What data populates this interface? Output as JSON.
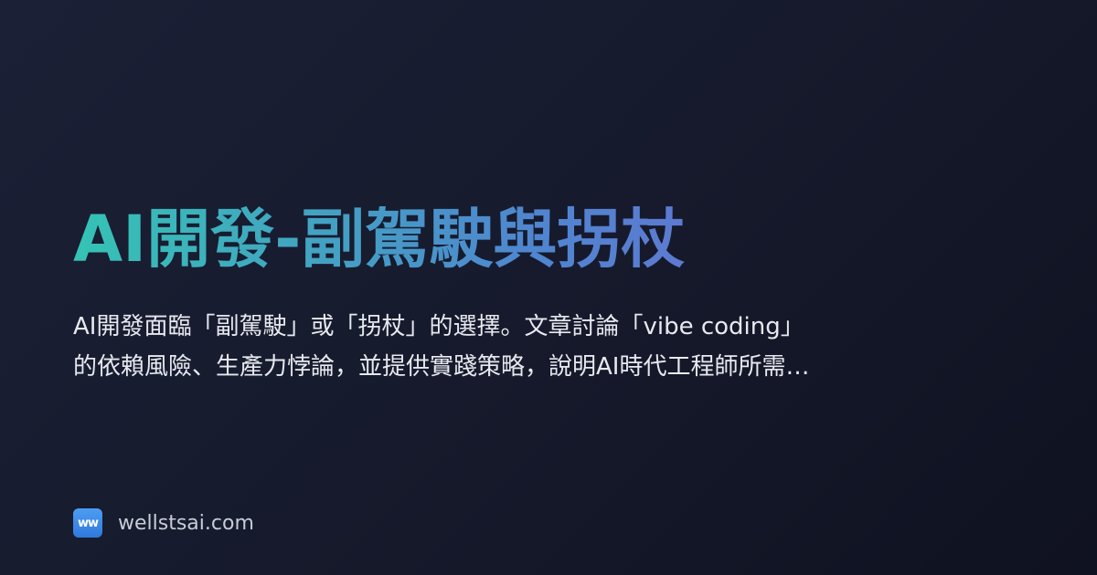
{
  "card": {
    "title": "AI開發-副駕駛與拐杖",
    "description_line1": "AI開發面臨「副駕駛」或「拐杖」的選擇。文章討論「vibe coding」",
    "description_line2": "的依賴風險、生產力悖論，並提供實踐策略，說明AI時代工程師所需…"
  },
  "footer": {
    "logo_text": "ww",
    "logo_icon": "site-logo-icon",
    "domain": "wellstsai.com"
  },
  "colors": {
    "background": "#171b2e",
    "title_gradient_start": "#35c3b4",
    "title_gradient_end": "#7a5fd6",
    "logo": "#3b8be6"
  }
}
